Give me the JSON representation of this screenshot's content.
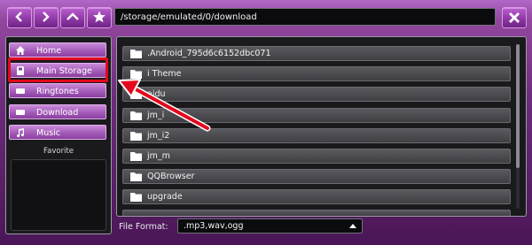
{
  "toolbar": {
    "buttons": [
      {
        "name": "back",
        "icon": "chevron-left-icon"
      },
      {
        "name": "forward",
        "icon": "chevron-right-icon"
      },
      {
        "name": "up",
        "icon": "chevron-up-icon"
      },
      {
        "name": "favorite",
        "icon": "star-icon"
      }
    ],
    "path": "/storage/emulated/0/download",
    "close_icon": "close-icon"
  },
  "sidebar": {
    "items": [
      {
        "label": "Home",
        "icon": "home-icon"
      },
      {
        "label": "Main Storage",
        "icon": "sd-card-icon"
      },
      {
        "label": "Ringtones",
        "icon": "ringtone-icon"
      },
      {
        "label": "Download",
        "icon": "download-icon"
      },
      {
        "label": "Music",
        "icon": "music-note-icon"
      }
    ],
    "favorite_label": "Favorite"
  },
  "files": [
    ".Android_795d6c6152dbc071",
    "i Theme",
    "aidu",
    "jm_i",
    "jm_i2",
    "jm_m",
    "QQBrowser",
    "upgrade"
  ],
  "footer": {
    "file_format_label": "File Format:",
    "file_format_value": ".mp3,wav,ogg"
  },
  "colors": {
    "accent": "#a158b6",
    "highlight": "#e3081c"
  }
}
